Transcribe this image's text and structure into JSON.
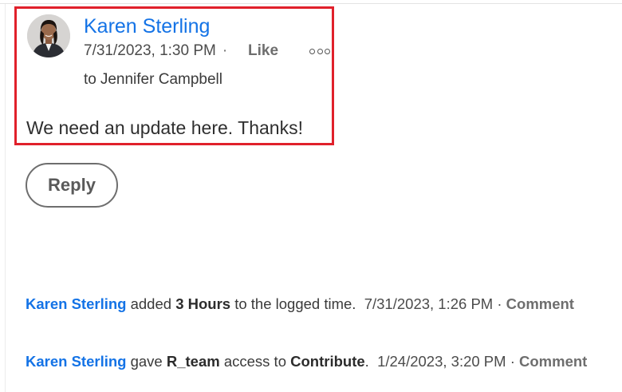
{
  "comment": {
    "author": "Karen Sterling",
    "timestamp": "7/31/2023, 1:30 PM",
    "separator": "·",
    "like_label": "Like",
    "more_icon": "more-options-icon",
    "recipient_prefix": "to",
    "recipient": "Jennifer Campbell",
    "body": "We need an update here. Thanks!",
    "highlight_color": "#e0202b"
  },
  "reply_label": "Reply",
  "activity": [
    {
      "user": "Karen Sterling",
      "verb": "added",
      "object": "3 Hours",
      "rest": "to the logged time.",
      "timestamp": "7/31/2023, 1:26 PM",
      "separator": "·",
      "comment_label": "Comment"
    },
    {
      "user": "Karen Sterling",
      "verb": "gave",
      "object": "R_team",
      "rest": "access to",
      "object2": "Contribute",
      "end": ".",
      "timestamp": "1/24/2023, 3:20 PM",
      "separator": "·",
      "comment_label": "Comment"
    }
  ],
  "colors": {
    "link": "#1473e6",
    "muted": "#6e6e6e",
    "text": "#2c2c2c"
  }
}
